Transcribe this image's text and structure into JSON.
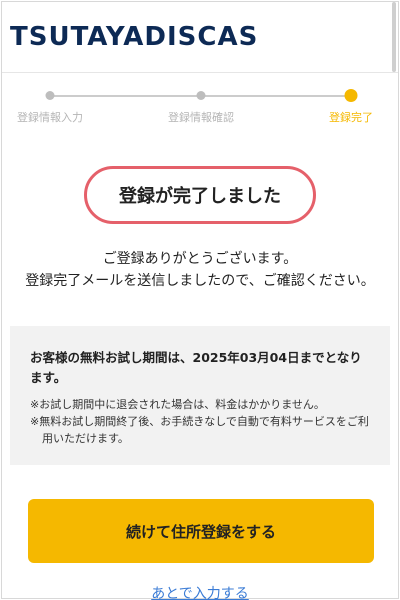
{
  "header": {
    "logo_part1": "TSUTAYA",
    "logo_part2": "DISCAS"
  },
  "stepper": {
    "steps": [
      {
        "label": "登録情報入力",
        "state": "done"
      },
      {
        "label": "登録情報確認",
        "state": "done"
      },
      {
        "label": "登録完了",
        "state": "current"
      }
    ],
    "active_color": "#f5b800"
  },
  "completion": {
    "title": "登録が完了しました"
  },
  "message": {
    "line1": "ご登録ありがとうございます。",
    "line2": "登録完了メールを送信しましたので、ご確認ください。"
  },
  "trial": {
    "headline": "お客様の無料お試し期間は、2025年03月04日までとなります。",
    "notes": [
      "※お試し期間中に退会された場合は、料金はかかりません。",
      "※無料お試し期間終了後、お手続きなしで自動で有料サービスをご利用いただけます。"
    ]
  },
  "actions": {
    "primary_label": "続けて住所登録をする",
    "later_label": "あとで入力する"
  },
  "colors": {
    "accent": "#f5b800",
    "highlight_border": "#e5606a",
    "link": "#3a7bd5",
    "logo": "#0d2a55"
  }
}
